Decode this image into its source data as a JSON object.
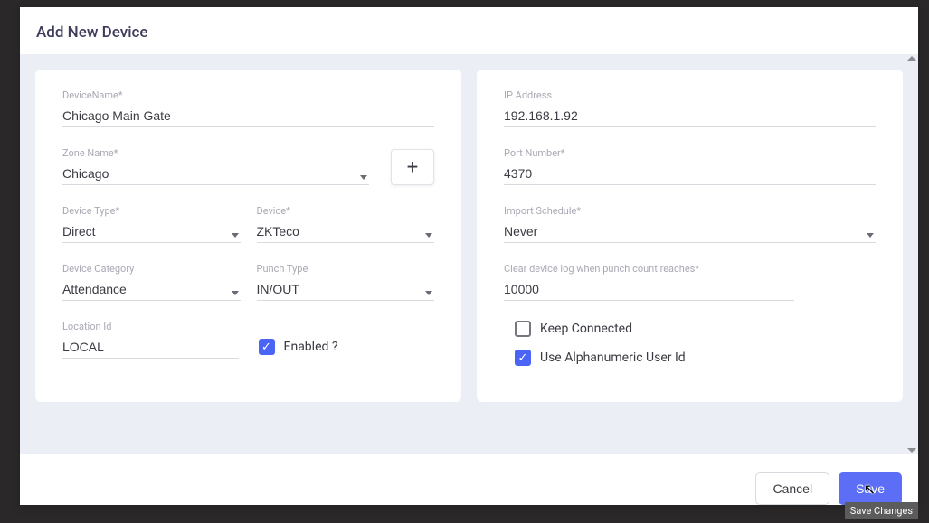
{
  "modal_title": "Add New Device",
  "left": {
    "device_name": {
      "label": "DeviceName*",
      "value": "Chicago Main Gate"
    },
    "zone_name": {
      "label": "Zone Name*",
      "value": "Chicago"
    },
    "add_button": "+",
    "device_type": {
      "label": "Device Type*",
      "value": "Direct"
    },
    "device": {
      "label": "Device*",
      "value": "ZKTeco"
    },
    "device_category": {
      "label": "Device Category",
      "value": "Attendance"
    },
    "punch_type": {
      "label": "Punch Type",
      "value": "IN/OUT"
    },
    "location_id": {
      "label": "Location Id",
      "value": "LOCAL"
    },
    "enabled_label": "Enabled ?"
  },
  "right": {
    "ip_address": {
      "label": "IP Address",
      "value": "192.168.1.92"
    },
    "port_number": {
      "label": "Port Number*",
      "value": "4370"
    },
    "import_schedule": {
      "label": "Import Schedule*",
      "value": "Never"
    },
    "clear_log": {
      "label": "Clear device log when punch count reaches*",
      "value": "10000"
    },
    "keep_connected": "Keep Connected",
    "alpha_user_id": "Use Alphanumeric User Id"
  },
  "footer": {
    "cancel": "Cancel",
    "save": "Save"
  },
  "tooltip": "Save Changes"
}
